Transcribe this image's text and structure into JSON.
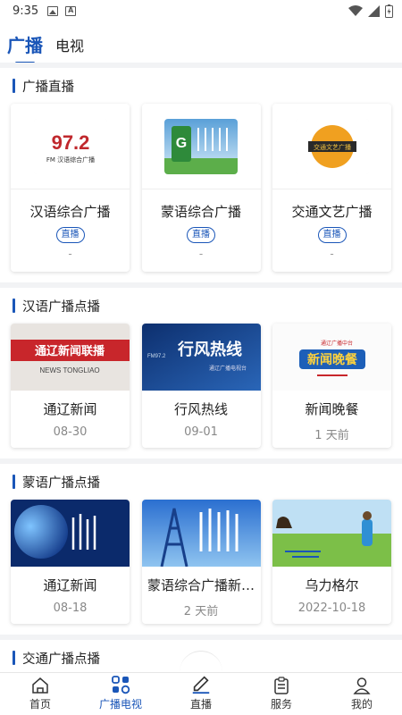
{
  "status_bar": {
    "time": "9:35"
  },
  "top_tabs": [
    {
      "label": "广播"
    },
    {
      "label": "电视"
    }
  ],
  "sections": [
    {
      "title": "广播直播",
      "items": [
        {
          "name": "汉语综合广播",
          "badge": "直播",
          "sub": "-",
          "logo_text": "97.2",
          "logo_sub": "FM 汉语综合广播"
        },
        {
          "name": "蒙语综合广播",
          "badge": "直播",
          "sub": "-"
        },
        {
          "name": "交通文艺广播",
          "badge": "直播",
          "sub": "-",
          "logo_text": "交通文艺广播"
        }
      ]
    },
    {
      "title": "汉语广播点播",
      "items": [
        {
          "title": "通辽新闻",
          "date": "08-30",
          "thumb_text": "通辽新闻联播",
          "thumb_sub": "NEWS TONGLIAO"
        },
        {
          "title": "行风热线",
          "date": "09-01",
          "thumb_text": "行风热线",
          "thumb_sub": "通辽广播电视台",
          "thumb_tag": "FM97.2"
        },
        {
          "title": "新闻晚餐",
          "date": "1 天前",
          "thumb_text": "新闻晚餐",
          "thumb_tag": "通辽广播中台"
        }
      ]
    },
    {
      "title": "蒙语广播点播",
      "items": [
        {
          "title": "通辽新闻",
          "date": "08-18"
        },
        {
          "title": "蒙语综合广播新…",
          "date": "2 天前"
        },
        {
          "title": "乌力格尔",
          "date": "2022-10-18"
        }
      ]
    },
    {
      "title": "交通广播点播"
    }
  ],
  "bottom_nav": [
    {
      "label": "首页",
      "icon": "home-icon"
    },
    {
      "label": "广播电视",
      "icon": "grid-icon"
    },
    {
      "label": "直播",
      "icon": "pen-icon"
    },
    {
      "label": "服务",
      "icon": "clipboard-icon"
    },
    {
      "label": "我的",
      "icon": "user-icon"
    }
  ],
  "colors": {
    "accent": "#1a56b8",
    "divider": "#f2f3f5"
  }
}
